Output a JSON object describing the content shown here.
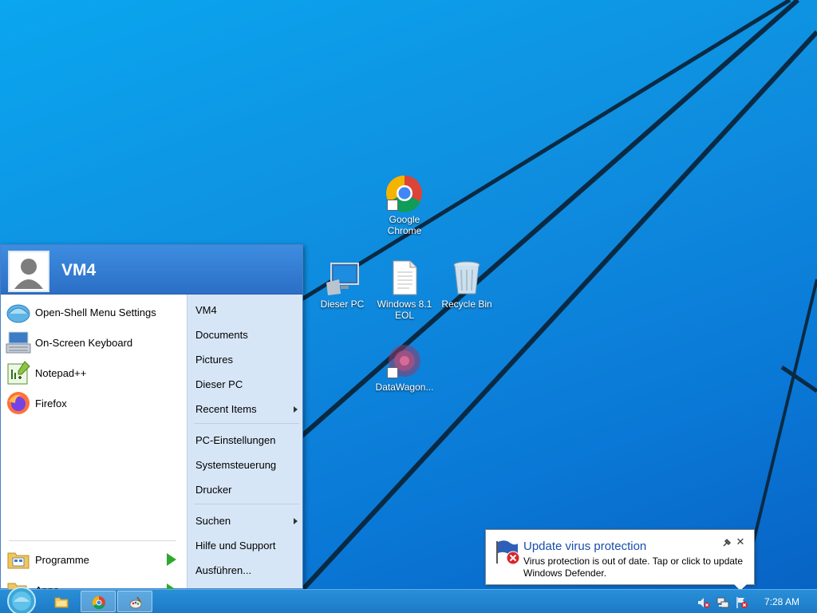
{
  "desktop": {
    "icons": [
      {
        "label": "Google Chrome",
        "icon": "chrome-icon"
      },
      {
        "label": "Dieser PC",
        "icon": "computer-icon"
      },
      {
        "label": "Windows 8.1 EOL",
        "icon": "text-file-icon"
      },
      {
        "label": "Recycle Bin",
        "icon": "recycle-bin-icon"
      },
      {
        "label": "DataWagon...",
        "icon": "datawagon-icon"
      }
    ]
  },
  "start_menu": {
    "user_name": "VM4",
    "pinned": [
      {
        "label": "Open-Shell Menu Settings",
        "icon": "shell-icon"
      },
      {
        "label": "On-Screen Keyboard",
        "icon": "keyboard-icon"
      },
      {
        "label": "Notepad++",
        "icon": "notepad-plus-icon"
      },
      {
        "label": "Firefox",
        "icon": "firefox-icon"
      }
    ],
    "bottom": [
      {
        "label": "Programme",
        "icon": "programs-folder-icon"
      },
      {
        "label": "Apps",
        "icon": "apps-icon"
      }
    ],
    "search_placeholder": "Suchen",
    "right_items": [
      {
        "label": "VM4"
      },
      {
        "label": "Documents"
      },
      {
        "label": "Pictures"
      },
      {
        "label": "Dieser PC"
      },
      {
        "label": "Recent Items"
      },
      {
        "label": "PC-Einstellungen"
      },
      {
        "label": "Systemsteuerung"
      },
      {
        "label": "Drucker"
      },
      {
        "label": "Suchen"
      },
      {
        "label": "Hilfe und Support"
      },
      {
        "label": "Ausführen..."
      }
    ]
  },
  "notification": {
    "title": "Update virus protection",
    "text": "Virus protection is out of date. Tap or click to update Windows Defender.",
    "close_glyph": "✕"
  },
  "taskbar": {
    "clock": "7:28 AM",
    "apps": [
      {
        "icon": "file-explorer-icon"
      },
      {
        "icon": "chrome-icon"
      },
      {
        "icon": "paint-icon"
      }
    ]
  },
  "colors": {
    "desktop": "#0f8fe0",
    "taskbar": "#1c7ac6",
    "start_header": "#2b6fc6",
    "right_pane": "#d7e6f7",
    "notification_title": "#1a4eab"
  }
}
